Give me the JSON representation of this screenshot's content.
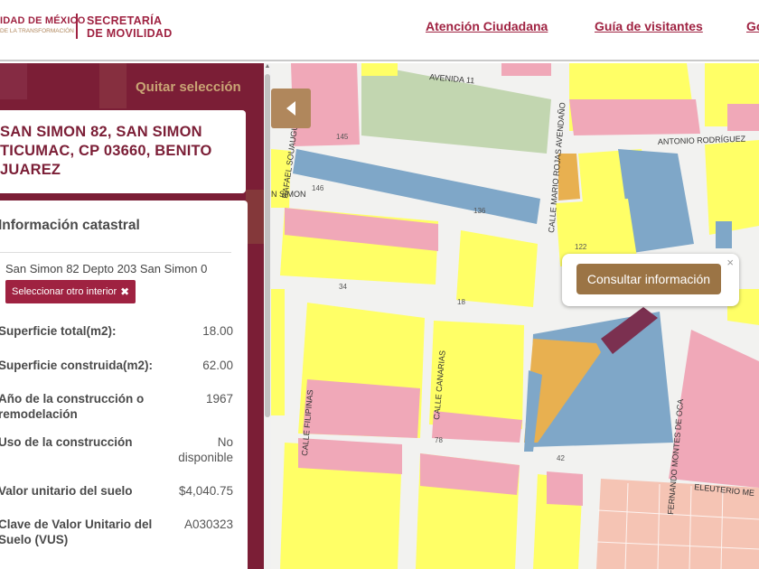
{
  "header": {
    "logo_line1": "IDAD DE MÉXICO",
    "logo_line2": "DE LA TRANSFORMACIÓN",
    "secretaria_line1": "SECRETARÍA",
    "secretaria_line2": "DE MOVILIDAD",
    "nav": [
      "Atención Ciudadana",
      "Guía de visitantes",
      "Go"
    ]
  },
  "panel": {
    "quitar_label": "Quitar selección",
    "address_lines": [
      "SAN SIMON 82, SAN SIMON",
      "TICUMAC, CP 03660, BENITO",
      "JUAREZ"
    ],
    "info_title": "Información catastral",
    "interior_text": "San Simon 82 Depto 203 San Simon 0",
    "interior_button": "Seleccionar otro interior",
    "interior_button_icon": "close-icon",
    "rows": [
      {
        "label": "Superficie total(m2):",
        "value": "18.00"
      },
      {
        "label": "Superficie construida(m2):",
        "value": "62.00"
      },
      {
        "label": "Año de la construcción o remodelación",
        "value": "1967"
      },
      {
        "label": "Uso de la construcción",
        "value": "No disponible"
      },
      {
        "label": "Valor unitario del suelo",
        "value": "$4,040.75"
      },
      {
        "label": "Clave de Valor Unitario del Suelo (VUS)",
        "value": "A030323"
      }
    ]
  },
  "map": {
    "collapse_icon": "caret-left-icon",
    "popup_button": "Consultar información",
    "popup_close": "×",
    "streets": [
      "AVENIDA 11",
      "RAFAEL SOUAUGU",
      "CALLE MARIO ROJAS AVENDAÑO",
      "ANTONIO RODRÍGUEZ",
      "N SIMON",
      "CALLE FILIPINAS",
      "CALLE CANARIAS",
      "FERNANDO MONTES DE OCA",
      "ELEUTERIO ME"
    ],
    "lot_numbers": [
      "145",
      "146",
      "136",
      "34",
      "18",
      "78",
      "42",
      "122"
    ],
    "colors": {
      "yellow": "#ffff66",
      "pink": "#f0a8b8",
      "blue": "#7fa7c8",
      "green": "#c2d6b0",
      "orange": "#e8b050",
      "salmon": "#f5c4b4",
      "selection": "#7b3050"
    }
  }
}
